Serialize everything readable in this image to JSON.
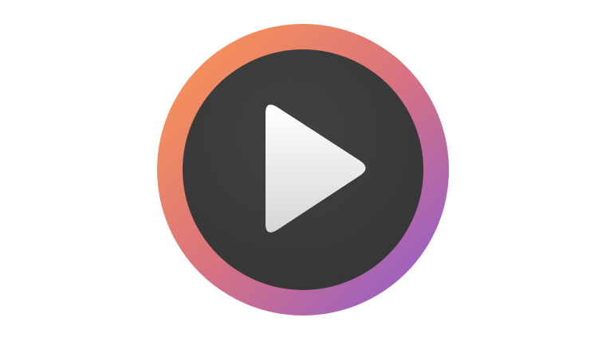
{
  "icon": {
    "name": "media-player-app-icon",
    "symbol": "play-icon",
    "colors": {
      "ring_gradient_start": "#ff9a4d",
      "ring_gradient_mid": "#d9737f",
      "ring_gradient_end": "#8a5bd6",
      "disc": "#363636",
      "disc_highlight": "#414141",
      "play_light": "#ffffff",
      "play_shade": "#d6d6d6"
    }
  }
}
